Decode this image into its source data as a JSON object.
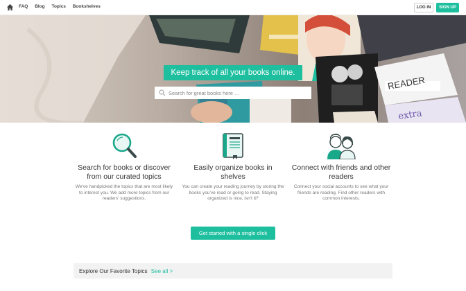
{
  "nav": {
    "links": [
      "FAQ",
      "Blog",
      "Topics",
      "Bookshelves"
    ],
    "login_label": "LOG IN",
    "signup_label": "SIGN UP",
    "home_icon": "home-icon"
  },
  "hero": {
    "title": "Keep track of all your books online.",
    "search_placeholder": "Search for great books here ...",
    "search_icon": "search-icon"
  },
  "features": [
    {
      "icon": "magnifier-icon",
      "title": "Search for books or discover from our curated topics",
      "text": "We've handpicked the topics that are most likely to interest you. We add more topics from our readers' suggestions."
    },
    {
      "icon": "book-icon",
      "title": "Easily organize books in shelves",
      "text": "You can create your reading journey by storing the books you've read or going to read. Staying organized is nice, isn't it?"
    },
    {
      "icon": "friends-icon",
      "title": "Connect with friends and other readers",
      "text": "Connect your social accounts to see what your friends are reading. Find other readers with common interests."
    }
  ],
  "cta_label": "Get started with a single click",
  "explore": {
    "title": "Explore Our Favorite Topics",
    "link": "See all >"
  },
  "colors": {
    "accent": "#1dbf9f",
    "text": "#333333",
    "muted": "#777777"
  }
}
